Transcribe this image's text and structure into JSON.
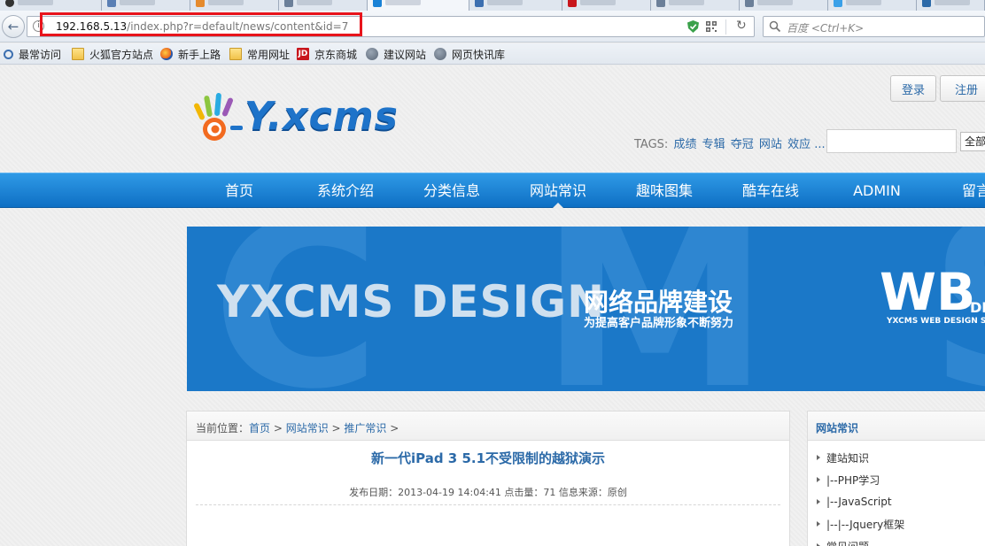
{
  "browser": {
    "url_host": "192.168.5.13",
    "url_path": "/index.php?r=default/news/content&id=7",
    "search_placeholder": "百度 <Ctrl+K>",
    "bookmarks": [
      "最常访问",
      "火狐官方站点",
      "新手上路",
      "常用网址",
      "京东商城",
      "建议网站",
      "网页快讯库"
    ]
  },
  "header": {
    "login_label": "登录",
    "register_label": "注册",
    "logo_text": "Y.xcms",
    "tags_label": "TAGS:",
    "tags": [
      "成绩",
      "专辑",
      "夺冠",
      "网站",
      "效应"
    ],
    "tags_more": "...",
    "search_scope": "全部"
  },
  "nav": {
    "items": [
      "首页",
      "系统介绍",
      "分类信息",
      "网站常识",
      "趣味图集",
      "酷车在线",
      "ADMIN",
      "留言"
    ],
    "active": "网站常识"
  },
  "banner": {
    "bg_letters": "CMS",
    "design_text": "YXCMS DESIGN",
    "brand_text": "网络品牌建设",
    "slogan": "为提高客户品牌形象不断努力",
    "wb_text": "WB",
    "de_text": "DE",
    "wb_sub": "YXCMS WEB DESIGN S"
  },
  "content": {
    "breadcrumb_prefix": "当前位置：",
    "breadcrumb_items": [
      "首页",
      "网站常识",
      "推广常识"
    ],
    "breadcrumb_sep": " > ",
    "title": "新一代iPad 3 5.1不受限制的越狱演示",
    "meta": "发布日期：2013-04-19 14:04:41  点击量：71  信息来源：原创"
  },
  "sidebar": {
    "title": "网站常识",
    "items": [
      "建站知识",
      "|--PHP学习",
      "|--JavaScript",
      "|--|--Jquery框架",
      "常见问题"
    ]
  },
  "colors": {
    "accent_blue": "#2c6aa8",
    "nav_blue": "#1a82d6",
    "banner_blue": "#1b78c8",
    "highlight_red": "#e8141c"
  }
}
